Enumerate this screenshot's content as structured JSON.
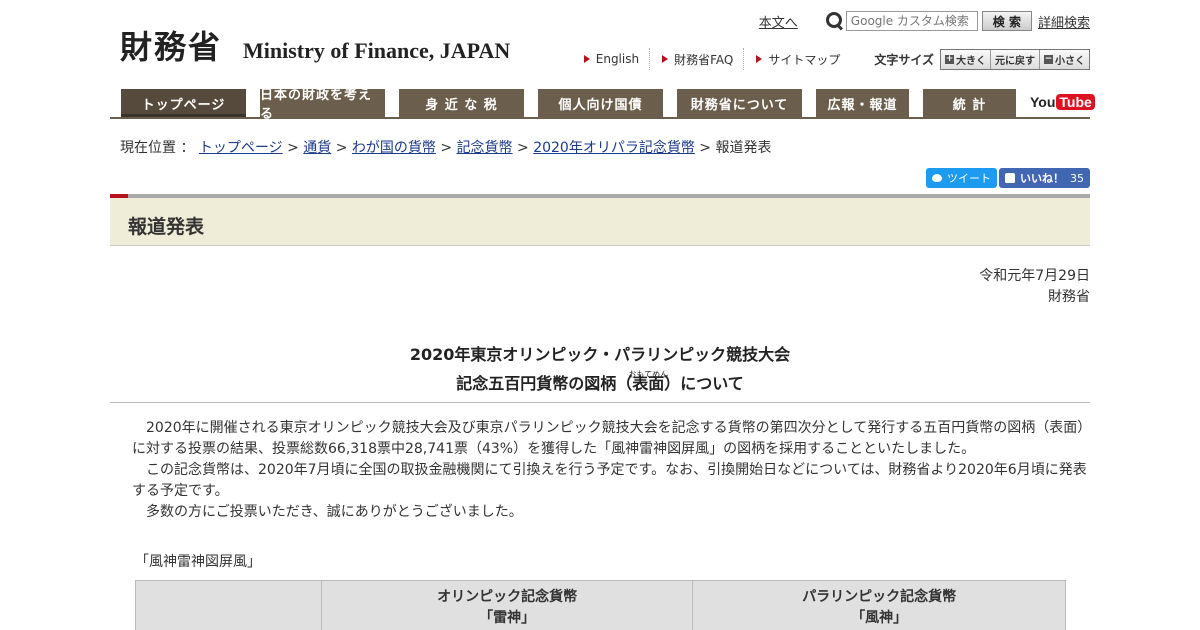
{
  "header": {
    "logo_jp": "財務省",
    "logo_en": "Ministry of Finance, JAPAN",
    "honbun_link": "本文へ",
    "search_placeholder": "Google カスタム検索",
    "search_button": "検 索",
    "advanced_search": "詳細検索",
    "util_links": [
      "English",
      "財務省FAQ",
      "サイトマップ"
    ],
    "font_size_label": "文字サイズ",
    "font_size_buttons": [
      "大きく",
      "元に戻す",
      "小さく"
    ]
  },
  "gnav": {
    "items": [
      "トップページ",
      "日本の財政を考える",
      "身 近 な 税",
      "個人向け国債",
      "財務省について",
      "広報・報道",
      "統 計"
    ],
    "youtube_you": "You",
    "youtube_tube": "Tube"
  },
  "breadcrumb": {
    "label": "現在位置 ：",
    "links": [
      "トップページ",
      "通貨",
      "わが国の貨幣",
      "記念貨幣",
      "2020年オリパラ記念貨幣"
    ],
    "separator": ">",
    "current": "報道発表"
  },
  "social": {
    "tweet": "ツイート",
    "like": "いいね！",
    "like_count": "35"
  },
  "page": {
    "title": "報道発表",
    "date": "令和元年7月29日",
    "issuer": "財務省",
    "title_line1": "2020年東京オリンピック・パラリンピック競技大会",
    "title_line2_a": "記念五百円貨幣の図柄（",
    "title_line2_ruby_base": "表面",
    "title_line2_ruby": "おもてめん",
    "title_line2_b": "）について",
    "paragraphs": [
      "2020年に開催される東京オリンピック競技大会及び東京パラリンピック競技大会を記念する貨幣の第四次分として発行する五百円貨幣の図柄（表面）に対する投票の結果、投票総数66,318票中28,741票（43%）を獲得した「風神雷神図屏風」の図柄を採用することといたしました。",
      "この記念貨幣は、2020年7月頃に全国の取扱金融機関にて引換えを行う予定です。なお、引換開始日などについては、財務省より2020年6月頃に発表する予定です。",
      "多数の方にご投票いただき、誠にありがとうございました。"
    ],
    "caption": "「風神雷神図屏風」",
    "table_headers": [
      {
        "line1": "",
        "line2": ""
      },
      {
        "line1": "オリンピック記念貨幣",
        "line2": "「雷神」"
      },
      {
        "line1": "パラリンピック記念貨幣",
        "line2": "「風神」"
      }
    ]
  }
}
